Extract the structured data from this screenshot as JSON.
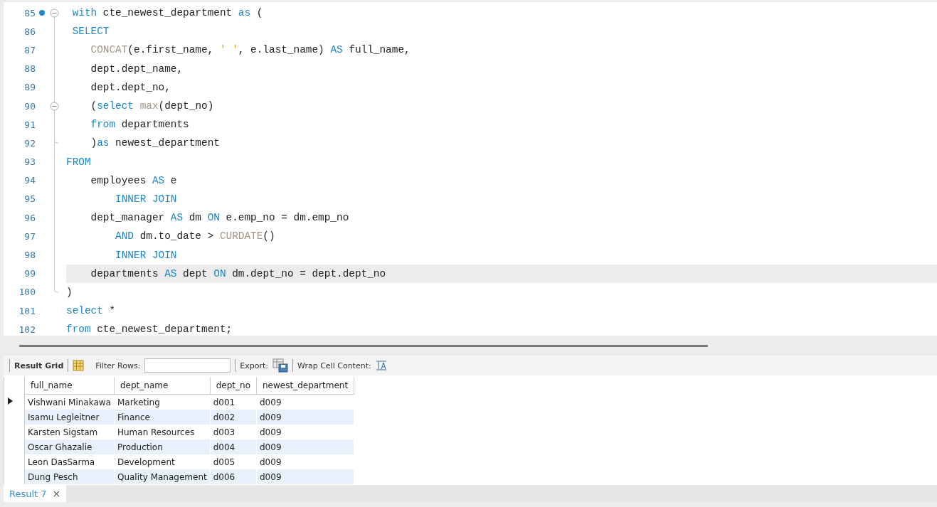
{
  "editor": {
    "lines": [
      {
        "number": "85",
        "breakpoint": true,
        "fold_start": true,
        "fold_end": false,
        "current": false,
        "tokens": [
          {
            "kind": "kw",
            "text": " with"
          },
          {
            "kind": "plain",
            "text": " cte_newest_department "
          },
          {
            "kind": "kw",
            "text": "as"
          },
          {
            "kind": "plain",
            "text": " ("
          }
        ]
      },
      {
        "number": "86",
        "breakpoint": false,
        "fold_start": false,
        "fold_end": false,
        "current": false,
        "tokens": [
          {
            "kind": "kw",
            "text": " SELECT"
          }
        ]
      },
      {
        "number": "87",
        "breakpoint": false,
        "fold_start": false,
        "fold_end": false,
        "current": false,
        "tokens": [
          {
            "kind": "fn",
            "text": "    CONCAT"
          },
          {
            "kind": "plain",
            "text": "(e.first_name, "
          },
          {
            "kind": "str",
            "text": "' '"
          },
          {
            "kind": "plain",
            "text": ", e.last_name) "
          },
          {
            "kind": "kw",
            "text": "AS"
          },
          {
            "kind": "plain",
            "text": " full_name,"
          }
        ]
      },
      {
        "number": "88",
        "breakpoint": false,
        "fold_start": false,
        "fold_end": false,
        "current": false,
        "tokens": [
          {
            "kind": "plain",
            "text": "    dept.dept_name,"
          }
        ]
      },
      {
        "number": "89",
        "breakpoint": false,
        "fold_start": false,
        "fold_end": false,
        "current": false,
        "tokens": [
          {
            "kind": "plain",
            "text": "    dept.dept_no,"
          }
        ]
      },
      {
        "number": "90",
        "breakpoint": false,
        "fold_start": true,
        "fold_end": false,
        "current": false,
        "tokens": [
          {
            "kind": "plain",
            "text": "    ("
          },
          {
            "kind": "kw",
            "text": "select"
          },
          {
            "kind": "fn",
            "text": " max"
          },
          {
            "kind": "plain",
            "text": "(dept_no)"
          }
        ]
      },
      {
        "number": "91",
        "breakpoint": false,
        "fold_start": false,
        "fold_end": false,
        "current": false,
        "tokens": [
          {
            "kind": "kw",
            "text": "    from"
          },
          {
            "kind": "plain",
            "text": " departments"
          }
        ]
      },
      {
        "number": "92",
        "breakpoint": false,
        "fold_start": false,
        "fold_end": true,
        "current": false,
        "tokens": [
          {
            "kind": "plain",
            "text": "    )"
          },
          {
            "kind": "kw",
            "text": "as"
          },
          {
            "kind": "plain",
            "text": " newest_department"
          }
        ]
      },
      {
        "number": "93",
        "breakpoint": false,
        "fold_start": false,
        "fold_end": false,
        "current": false,
        "tokens": [
          {
            "kind": "kw",
            "text": "FROM"
          }
        ]
      },
      {
        "number": "94",
        "breakpoint": false,
        "fold_start": false,
        "fold_end": false,
        "current": false,
        "tokens": [
          {
            "kind": "plain",
            "text": "    employees "
          },
          {
            "kind": "kw",
            "text": "AS"
          },
          {
            "kind": "plain",
            "text": " e"
          }
        ]
      },
      {
        "number": "95",
        "breakpoint": false,
        "fold_start": false,
        "fold_end": false,
        "current": false,
        "tokens": [
          {
            "kind": "kw",
            "text": "        INNER JOIN"
          }
        ]
      },
      {
        "number": "96",
        "breakpoint": false,
        "fold_start": false,
        "fold_end": false,
        "current": false,
        "tokens": [
          {
            "kind": "plain",
            "text": "    dept_manager "
          },
          {
            "kind": "kw",
            "text": "AS"
          },
          {
            "kind": "plain",
            "text": " dm "
          },
          {
            "kind": "kw",
            "text": "ON"
          },
          {
            "kind": "plain",
            "text": " e.emp_no = dm.emp_no"
          }
        ]
      },
      {
        "number": "97",
        "breakpoint": false,
        "fold_start": false,
        "fold_end": false,
        "current": false,
        "tokens": [
          {
            "kind": "kw",
            "text": "        AND"
          },
          {
            "kind": "plain",
            "text": " dm.to_date > "
          },
          {
            "kind": "fn",
            "text": "CURDATE"
          },
          {
            "kind": "plain",
            "text": "()"
          }
        ]
      },
      {
        "number": "98",
        "breakpoint": false,
        "fold_start": false,
        "fold_end": false,
        "current": false,
        "tokens": [
          {
            "kind": "kw",
            "text": "        INNER JOIN"
          }
        ]
      },
      {
        "number": "99",
        "breakpoint": false,
        "fold_start": false,
        "fold_end": false,
        "current": true,
        "tokens": [
          {
            "kind": "plain",
            "text": "    departments "
          },
          {
            "kind": "kw",
            "text": "AS"
          },
          {
            "kind": "plain",
            "text": " dept "
          },
          {
            "kind": "kw",
            "text": "ON"
          },
          {
            "kind": "plain",
            "text": " dm.dept_no = dept.dept_no"
          }
        ]
      },
      {
        "number": "100",
        "breakpoint": false,
        "fold_start": false,
        "fold_end": true,
        "current": false,
        "tokens": [
          {
            "kind": "plain",
            "text": ")"
          }
        ]
      },
      {
        "number": "101",
        "breakpoint": false,
        "fold_start": false,
        "fold_end": false,
        "current": false,
        "tokens": [
          {
            "kind": "kw",
            "text": "select"
          },
          {
            "kind": "plain",
            "text": " *"
          }
        ]
      },
      {
        "number": "102",
        "breakpoint": false,
        "fold_start": false,
        "fold_end": false,
        "current": false,
        "tokens": [
          {
            "kind": "kw",
            "text": "from"
          },
          {
            "kind": "plain",
            "text": " cte_newest_department;"
          }
        ]
      }
    ]
  },
  "results": {
    "toolbar": {
      "grid_label": "Result Grid",
      "filter_label": "Filter Rows:",
      "export_label": "Export:",
      "wrap_label": "Wrap Cell Content:"
    },
    "grid": {
      "columns": [
        "full_name",
        "dept_name",
        "dept_no",
        "newest_department"
      ],
      "rows": [
        {
          "selected": true,
          "cells": [
            "Vishwani Minakawa",
            "Marketing",
            "d001",
            "d009"
          ]
        },
        {
          "selected": false,
          "cells": [
            "Isamu Legleitner",
            "Finance",
            "d002",
            "d009"
          ]
        },
        {
          "selected": false,
          "cells": [
            "Karsten Sigstam",
            "Human Resources",
            "d003",
            "d009"
          ]
        },
        {
          "selected": false,
          "cells": [
            "Oscar Ghazalie",
            "Production",
            "d004",
            "d009"
          ]
        },
        {
          "selected": false,
          "cells": [
            "Leon DasSarma",
            "Development",
            "d005",
            "d009"
          ]
        },
        {
          "selected": false,
          "cells": [
            "Dung Pesch",
            "Quality Management",
            "d006",
            "d009"
          ]
        }
      ]
    }
  },
  "tabs": [
    {
      "label": "Result 7",
      "close": "×",
      "selected": true
    }
  ]
}
